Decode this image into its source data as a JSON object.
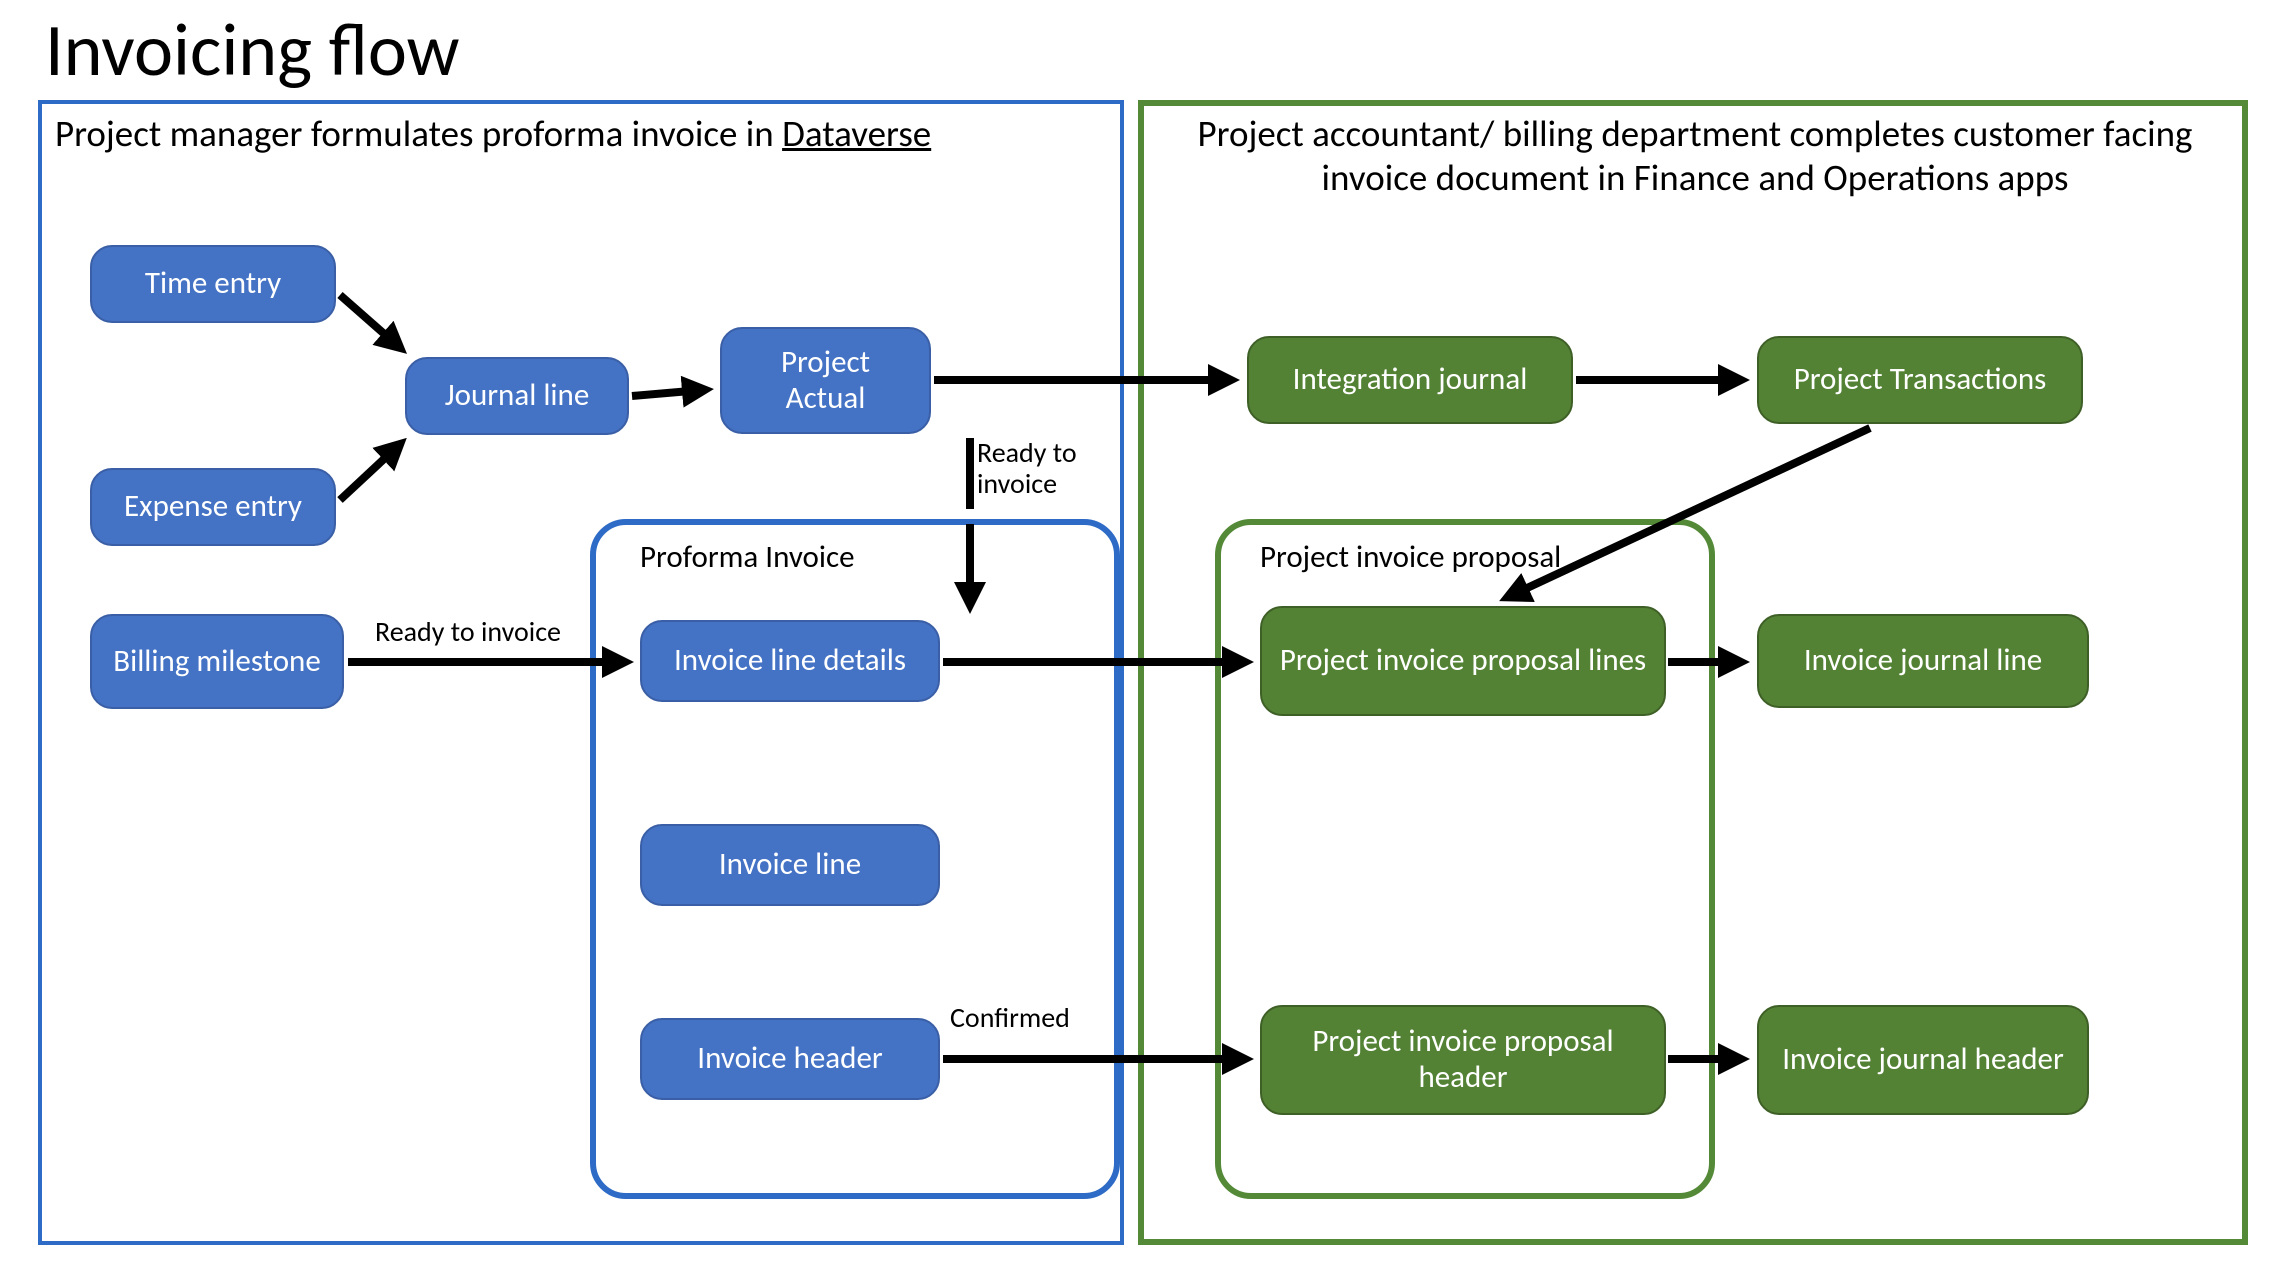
{
  "title": "Invoicing flow",
  "regions": {
    "left": {
      "label_prefix": "Project manager formulates proforma invoice in ",
      "label_underlined": "Dataverse"
    },
    "right": {
      "label": "Project accountant/ billing department completes customer facing invoice document in Finance and Operations apps"
    }
  },
  "subregions": {
    "proforma": "Proforma Invoice",
    "proposal": "Project invoice proposal"
  },
  "nodes": {
    "time_entry": "Time entry",
    "expense_entry": "Expense entry",
    "journal_line": "Journal line",
    "project_actual": "Project\nActual",
    "billing_milestone": "Billing milestone",
    "invoice_line_details": "Invoice line details",
    "invoice_line": "Invoice line",
    "invoice_header": "Invoice header",
    "integration_journal": "Integration journal",
    "project_transactions": "Project Transactions",
    "proposal_lines": "Project invoice proposal lines",
    "proposal_header": "Project invoice proposal header",
    "invoice_journal_line": "Invoice journal line",
    "invoice_journal_header": "Invoice journal header"
  },
  "edge_labels": {
    "ready_to_invoice_1": "Ready to invoice",
    "ready_to_invoice_2": "Ready to invoice",
    "confirmed": "Confirmed"
  }
}
